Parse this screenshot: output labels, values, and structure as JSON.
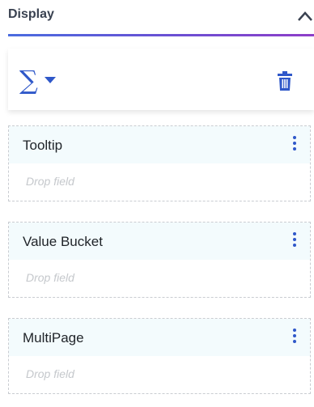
{
  "header": {
    "title": "Display",
    "collapse_icon": "chevron-up-icon"
  },
  "toolbar": {
    "sum_icon": "sigma-icon",
    "sum_symbol": "∑",
    "dropdown_icon": "caret-down-icon",
    "delete_icon": "trash-icon"
  },
  "drop_zones": [
    {
      "label": "Tooltip",
      "placeholder": "Drop field"
    },
    {
      "label": "Value Bucket",
      "placeholder": "Drop field"
    },
    {
      "label": "MultiPage",
      "placeholder": "Drop field"
    }
  ],
  "colors": {
    "accent": "#2f58c9",
    "gradient_start": "#4a6cdf",
    "gradient_end": "#8e3ec8"
  }
}
